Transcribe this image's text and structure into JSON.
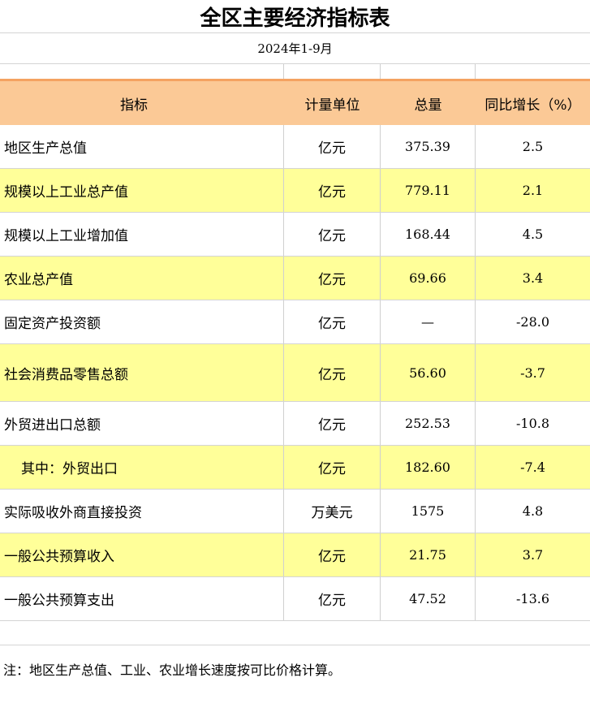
{
  "title": "全区主要经济指标表",
  "subtitle": "2024年1-9月",
  "headers": {
    "indicator": "指标",
    "unit": "计量单位",
    "total": "总量",
    "growth": "同比增长（%）"
  },
  "rows": [
    {
      "indicator": "地区生产总值",
      "unit": "亿元",
      "total": "375.39",
      "growth": "2.5",
      "highlight": false,
      "indent": false
    },
    {
      "indicator": "规模以上工业总产值",
      "unit": "亿元",
      "total": "779.11",
      "growth": "2.1",
      "highlight": true,
      "indent": false
    },
    {
      "indicator": "规模以上工业增加值",
      "unit": "亿元",
      "total": "168.44",
      "growth": "4.5",
      "highlight": false,
      "indent": false
    },
    {
      "indicator": "农业总产值",
      "unit": "亿元",
      "total": "69.66",
      "growth": "3.4",
      "highlight": true,
      "indent": false
    },
    {
      "indicator": "固定资产投资额",
      "unit": "亿元",
      "total": "—",
      "growth": "-28.0",
      "highlight": false,
      "indent": false
    },
    {
      "indicator": "社会消费品零售总额",
      "unit": "亿元",
      "total": "56.60",
      "growth": "-3.7",
      "highlight": true,
      "indent": false
    },
    {
      "indicator": "外贸进出口总额",
      "unit": "亿元",
      "total": "252.53",
      "growth": "-10.8",
      "highlight": false,
      "indent": false
    },
    {
      "indicator": "其中：外贸出口",
      "unit": "亿元",
      "total": "182.60",
      "growth": "-7.4",
      "highlight": true,
      "indent": true
    },
    {
      "indicator": "实际吸收外商直接投资",
      "unit": "万美元",
      "total": "1575",
      "growth": "4.8",
      "highlight": false,
      "indent": false
    },
    {
      "indicator": "一般公共预算收入",
      "unit": "亿元",
      "total": "21.75",
      "growth": "3.7",
      "highlight": true,
      "indent": false
    },
    {
      "indicator": "一般公共预算支出",
      "unit": "亿元",
      "total": "47.52",
      "growth": "-13.6",
      "highlight": false,
      "indent": false
    }
  ],
  "note": "注：地区生产总值、工业、农业增长速度按可比价格计算。",
  "colors": {
    "header_bg": "#fbc996",
    "header_border": "#f4a261",
    "highlight_bg": "#ffff99"
  }
}
